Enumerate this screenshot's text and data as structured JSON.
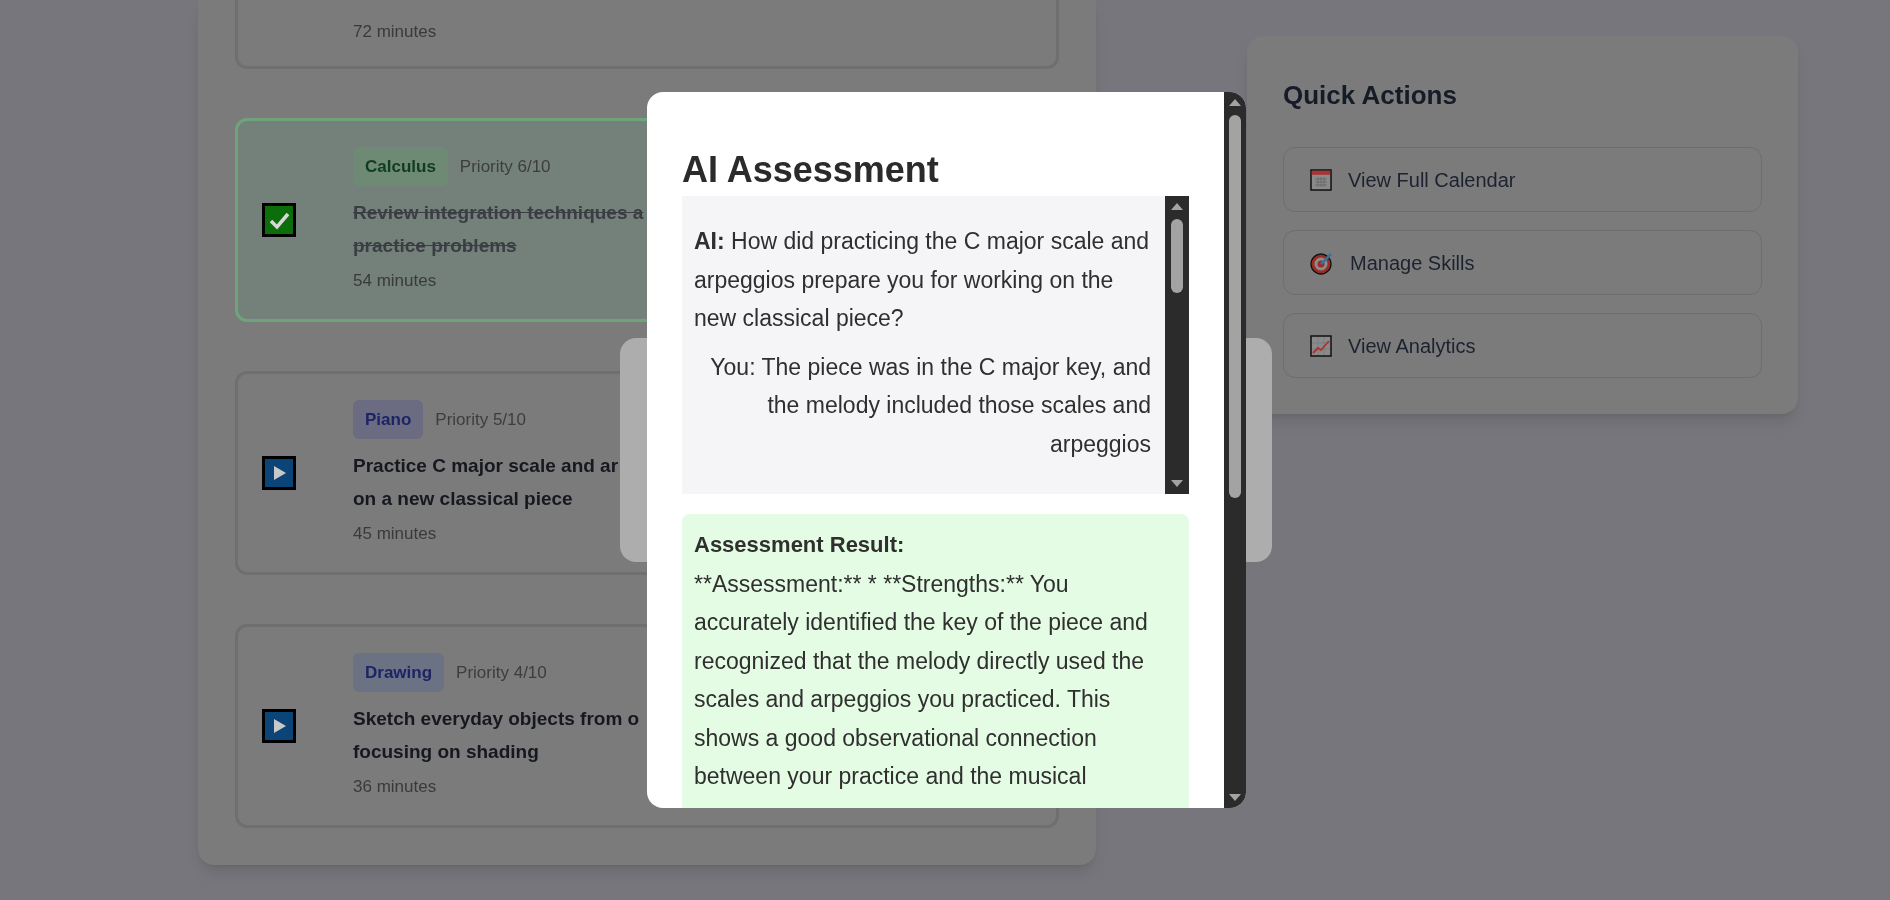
{
  "tasks": [
    {
      "duration": "72 minutes"
    },
    {
      "tag": "Calculus",
      "color": "#6f8a74",
      "priority": "Priority 6/10",
      "title_lines": [
        "Review integration techniques a",
        "practice problems"
      ],
      "duration": "54 minutes",
      "done": true
    },
    {
      "tag": "Piano",
      "color": "#6b6b82",
      "priority": "Priority 5/10",
      "title_lines": [
        "Practice C major scale and ar",
        "on a new classical piece"
      ],
      "duration": "45 minutes",
      "done": false
    },
    {
      "tag": "Drawing",
      "color": "#6b7283",
      "priority": "Priority 4/10",
      "title_lines": [
        "Sketch everyday objects from o",
        "focusing on shading"
      ],
      "duration": "36 minutes",
      "done": false
    }
  ],
  "quick_actions": {
    "title": "Quick Actions",
    "items": [
      {
        "kind": "calendar",
        "label": "View Full Calendar"
      },
      {
        "kind": "target",
        "label": "Manage Skills"
      },
      {
        "kind": "chart",
        "label": "View Analytics"
      }
    ]
  },
  "modal": {
    "title": "AI Assessment",
    "messages": [
      {
        "kind": "ai",
        "speaker": "AI:",
        "text": "How did practicing the C major scale and arpeggios prepare you for working on the new classical piece?"
      },
      {
        "kind": "user",
        "speaker": "You:",
        "text": "The piece was in the C major key, and the melody included those scales and arpeggios"
      }
    ],
    "result": {
      "title": "Assessment Result:",
      "text": "**Assessment:** * **Strengths:** You accurately identified the key of the piece and recognized that the melody directly used the scales and arpeggios you practiced. This shows a good observational connection between your practice and the musical"
    }
  }
}
